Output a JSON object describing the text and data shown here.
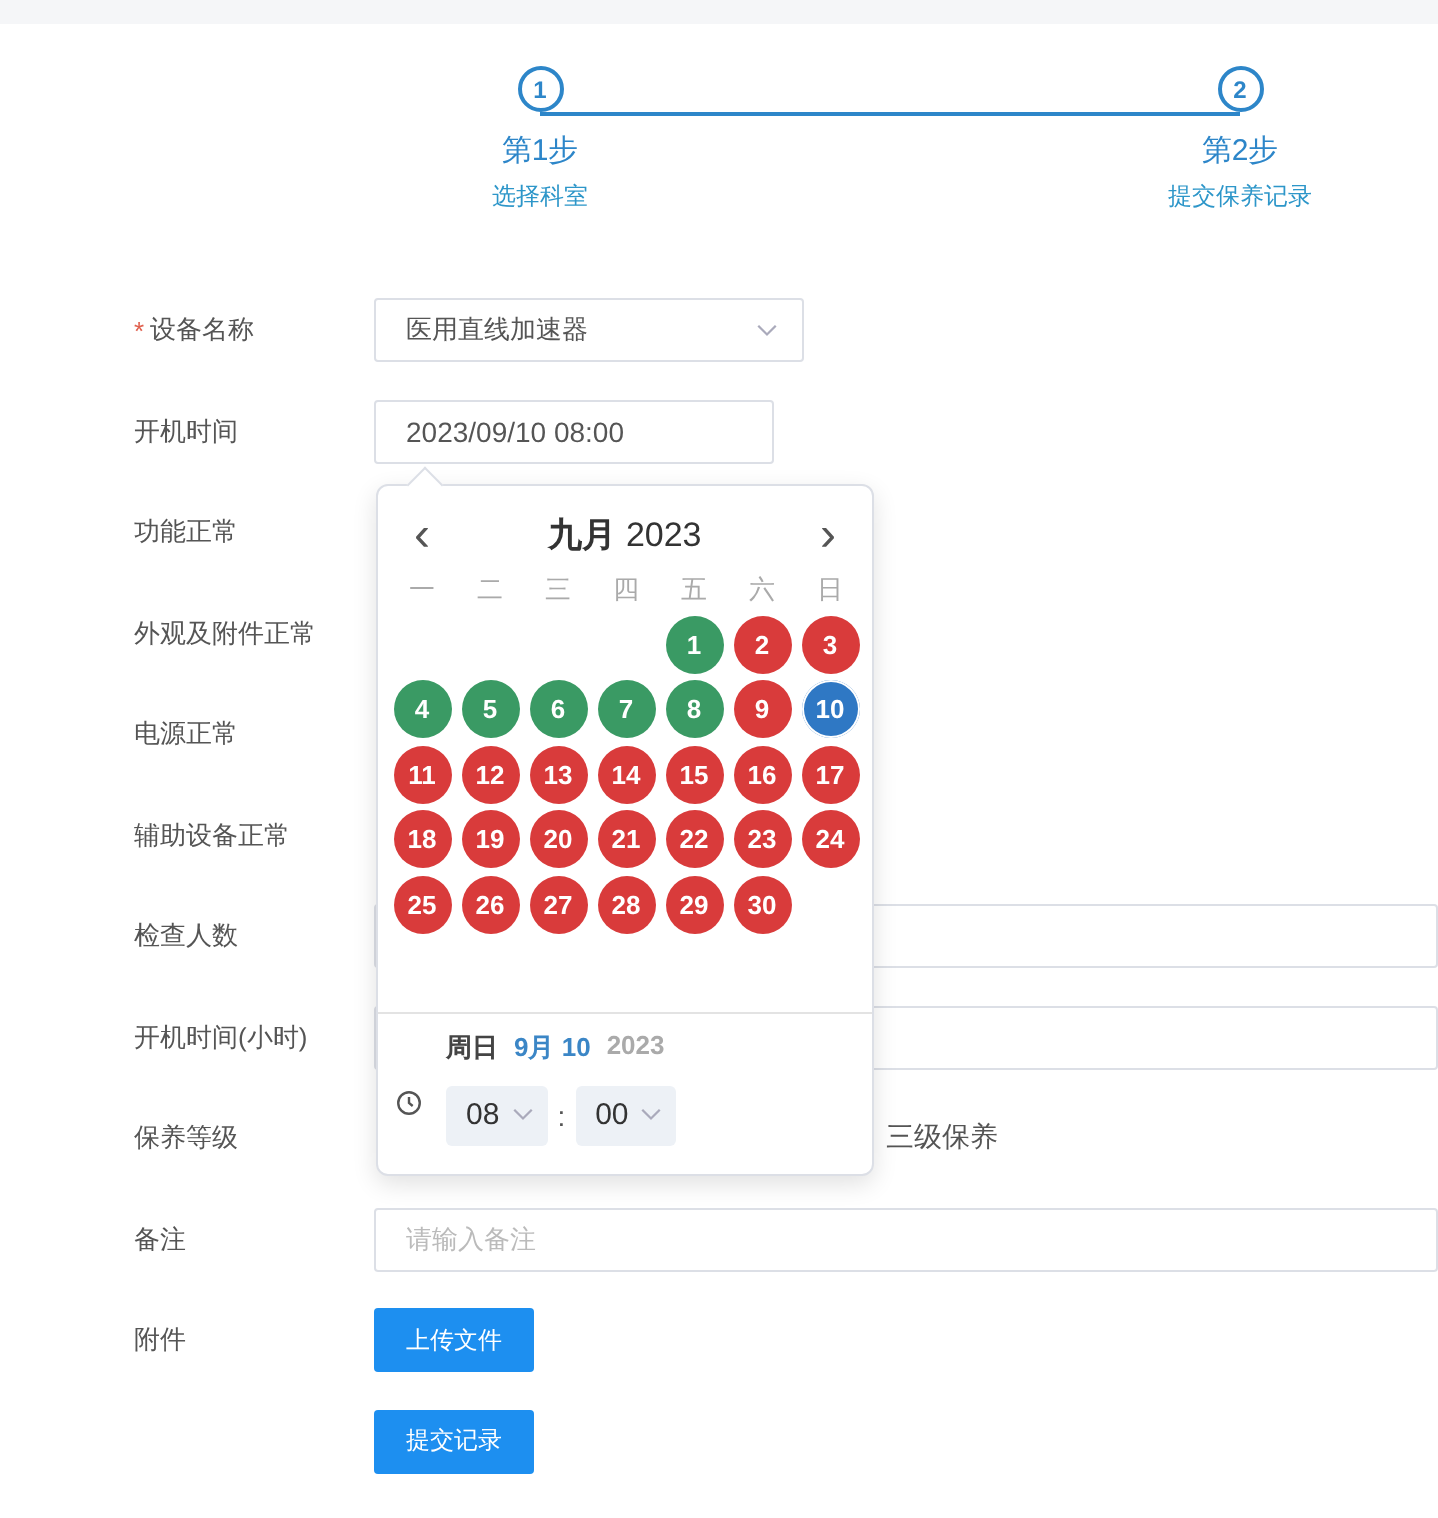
{
  "steps": [
    {
      "number": "1",
      "title": "第1步",
      "subtitle": "选择科室"
    },
    {
      "number": "2",
      "title": "第2步",
      "subtitle": "提交保养记录"
    }
  ],
  "form": {
    "rows": [
      {
        "kind": "select",
        "mark": "*",
        "label": "设备名称",
        "value": "医用直线加速器"
      },
      {
        "kind": "datetime",
        "label": "开机时间",
        "value": "2023/09/10 08:00"
      },
      {
        "kind": "hidden",
        "label": "功能正常"
      },
      {
        "kind": "hidden",
        "label": "外观及附件正常"
      },
      {
        "kind": "hidden",
        "label": "电源正常"
      },
      {
        "kind": "hidden",
        "label": "辅助设备正常"
      },
      {
        "kind": "input",
        "label": "检查人数"
      },
      {
        "kind": "input",
        "label": "开机时间(小时)"
      },
      {
        "kind": "radio",
        "label": "保养等级",
        "options": [
          "三级保养"
        ]
      },
      {
        "kind": "input",
        "label": "备注",
        "placeholder": "请输入备注"
      },
      {
        "kind": "button",
        "label": "附件",
        "button": "上传文件"
      },
      {
        "kind": "button",
        "button": "提交记录"
      }
    ]
  },
  "date_picker": {
    "prev": "‹",
    "next": "›",
    "month": "九月",
    "year": "2023",
    "weekdays": [
      "一",
      "二",
      "三",
      "四",
      "五",
      "六",
      "日"
    ],
    "weeks": [
      [
        {
          "day": "1",
          "color": "#3a9a64",
          "selected": false
        },
        {
          "day": "2",
          "color": "#d93b3b",
          "selected": false
        },
        {
          "day": "3",
          "color": "#d93b3b",
          "selected": false
        }
      ],
      [
        {
          "day": "4",
          "color": "#3a9a64",
          "selected": false
        },
        {
          "day": "5",
          "color": "#3a9a64",
          "selected": false
        },
        {
          "day": "6",
          "color": "#3a9a64",
          "selected": false
        },
        {
          "day": "7",
          "color": "#3a9a64",
          "selected": false
        },
        {
          "day": "8",
          "color": "#3a9a64",
          "selected": false
        },
        {
          "day": "9",
          "color": "#d93b3b",
          "selected": false
        },
        {
          "day": "10",
          "color": "#2f78c4",
          "selected": true
        }
      ],
      [
        {
          "day": "11",
          "color": "#d93b3b",
          "selected": false
        },
        {
          "day": "12",
          "color": "#d93b3b",
          "selected": false
        },
        {
          "day": "13",
          "color": "#d93b3b",
          "selected": false
        },
        {
          "day": "14",
          "color": "#d93b3b",
          "selected": false
        },
        {
          "day": "15",
          "color": "#d93b3b",
          "selected": false
        },
        {
          "day": "16",
          "color": "#d93b3b",
          "selected": false
        },
        {
          "day": "17",
          "color": "#d93b3b",
          "selected": false
        }
      ],
      [
        {
          "day": "18",
          "color": "#d93b3b",
          "selected": false
        },
        {
          "day": "19",
          "color": "#d93b3b",
          "selected": false
        },
        {
          "day": "20",
          "color": "#d93b3b",
          "selected": false
        },
        {
          "day": "21",
          "color": "#d93b3b",
          "selected": false
        },
        {
          "day": "22",
          "color": "#d93b3b",
          "selected": false
        },
        {
          "day": "23",
          "color": "#d93b3b",
          "selected": false
        },
        {
          "day": "24",
          "color": "#d93b3b",
          "selected": false
        }
      ],
      [
        {
          "day": "25",
          "color": "#d93b3b",
          "selected": false
        },
        {
          "day": "26",
          "color": "#d93b3b",
          "selected": false
        },
        {
          "day": "27",
          "color": "#d93b3b",
          "selected": false
        },
        {
          "day": "28",
          "color": "#d93b3b",
          "selected": false
        },
        {
          "day": "29",
          "color": "#d93b3b",
          "selected": false
        },
        {
          "day": "30",
          "color": "#d93b3b",
          "selected": false
        }
      ]
    ],
    "footer": {
      "weekday": "周日",
      "date": "9月 10",
      "year": "2023",
      "hour": "08",
      "separator": ":",
      "minute": "00"
    }
  }
}
